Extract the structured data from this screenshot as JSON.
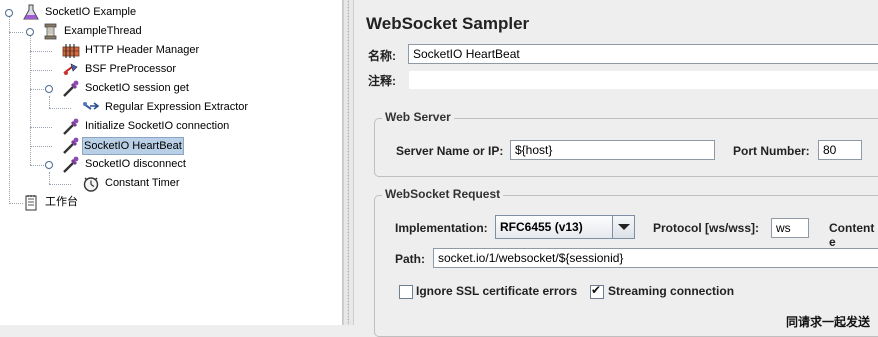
{
  "tree": {
    "items": [
      {
        "label": "SocketIO Example",
        "icon": "test-plan-flask-icon"
      },
      {
        "label": "ExampleThread",
        "icon": "thread-group-spool-icon"
      },
      {
        "label": "HTTP Header Manager",
        "icon": "header-manager-icon"
      },
      {
        "label": "BSF PreProcessor",
        "icon": "preprocessor-icon"
      },
      {
        "label": "SocketIO session get",
        "icon": "sampler-pipette-icon"
      },
      {
        "label": "Regular Expression Extractor",
        "icon": "extractor-icon"
      },
      {
        "label": "Initialize SocketIO connection",
        "icon": "sampler-pipette-icon"
      },
      {
        "label": "SocketIO HeartBeat",
        "icon": "sampler-pipette-icon",
        "selected": true
      },
      {
        "label": "SocketIO disconnect",
        "icon": "sampler-pipette-icon"
      },
      {
        "label": "Constant Timer",
        "icon": "timer-stopwatch-icon"
      },
      {
        "label": "工作台",
        "icon": "workbench-notepad-icon"
      }
    ]
  },
  "panel": {
    "title": "WebSocket Sampler",
    "name_label": "名称:",
    "name_value": "SocketIO HeartBeat",
    "comment_label": "注释:",
    "comment_value": "",
    "web_server": {
      "title": "Web Server",
      "server_label": "Server Name or IP:",
      "server_value": "${host}",
      "port_label": "Port Number:",
      "port_value": "80"
    },
    "ws_request": {
      "title": "WebSocket Request",
      "impl_label": "Implementation:",
      "impl_value": "RFC6455 (v13)",
      "protocol_label": "Protocol [ws/wss]:",
      "protocol_value": "ws",
      "content_label": "Content e",
      "path_label": "Path:",
      "path_value": "socket.io/1/websocket/${sessionid}",
      "ignore_ssl_label": "Ignore SSL certificate errors",
      "ignore_ssl_checked": false,
      "streaming_label": "Streaming connection",
      "streaming_checked": true,
      "cutoff_text": "同请求一起发送"
    }
  }
}
